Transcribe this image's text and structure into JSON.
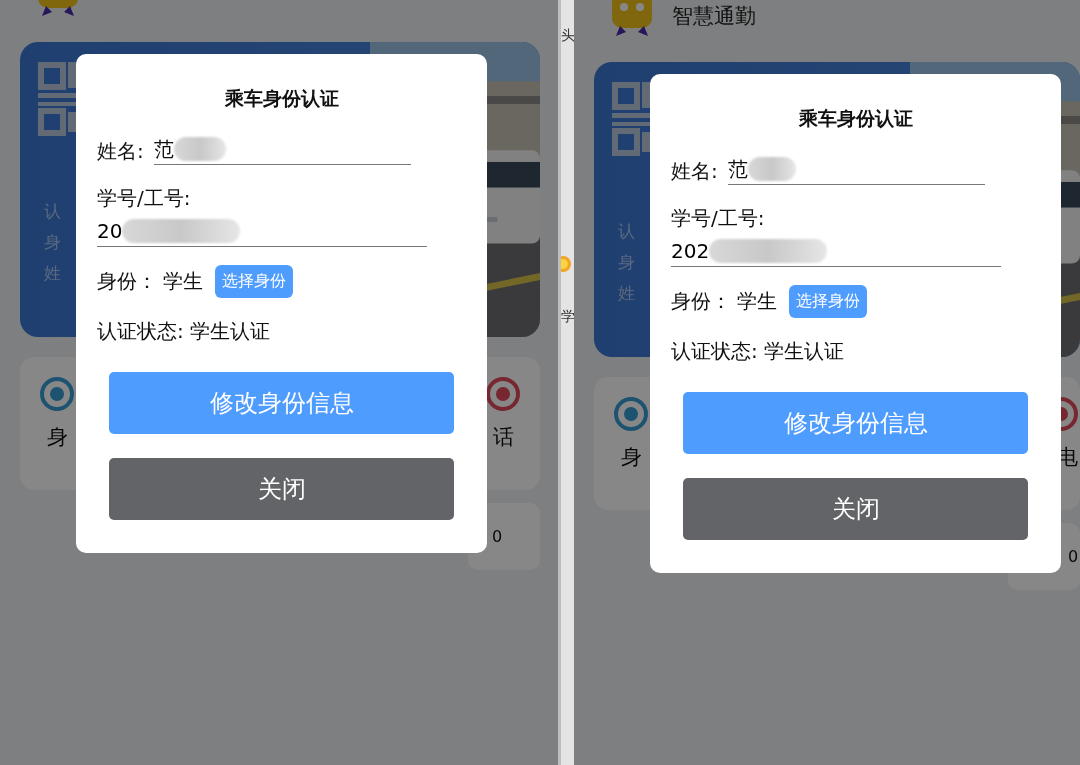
{
  "panes": [
    {
      "card_lines": [
        "认",
        "身",
        "姓"
      ],
      "features": [
        "身",
        "话"
      ],
      "stat": "0",
      "modal": {
        "title": "乘车身份认证",
        "name_label": "姓名:",
        "name_value": "范",
        "id_label": "学号/工号:",
        "id_value": "20",
        "role_label": "身份：",
        "role_value": "学生",
        "role_button": "选择身份",
        "status": "认证状态: 学生认证",
        "buttons": [
          {
            "kind": "primary",
            "label": "修改身份信息"
          },
          {
            "kind": "secondary",
            "label": "关闭"
          }
        ]
      }
    },
    {
      "app_title": "智慧通勤",
      "card_lines": [
        "认",
        "身",
        "姓"
      ],
      "features": [
        "身",
        "电"
      ],
      "stat": "0",
      "modal": {
        "title": "乘车身份认证",
        "name_label": "姓名:",
        "name_value": "范",
        "id_label": "学号/工号:",
        "id_value": "202",
        "role_label": "身份：",
        "role_value": "学生",
        "role_button": "选择身份",
        "status": "认证状态: 学生认证",
        "buttons": [
          {
            "kind": "primary",
            "label": "修改身份信息"
          },
          {
            "kind": "secondary",
            "label": "关闭"
          }
        ]
      }
    }
  ],
  "gutter": {
    "top_text": "头",
    "bottom_text": "学"
  }
}
